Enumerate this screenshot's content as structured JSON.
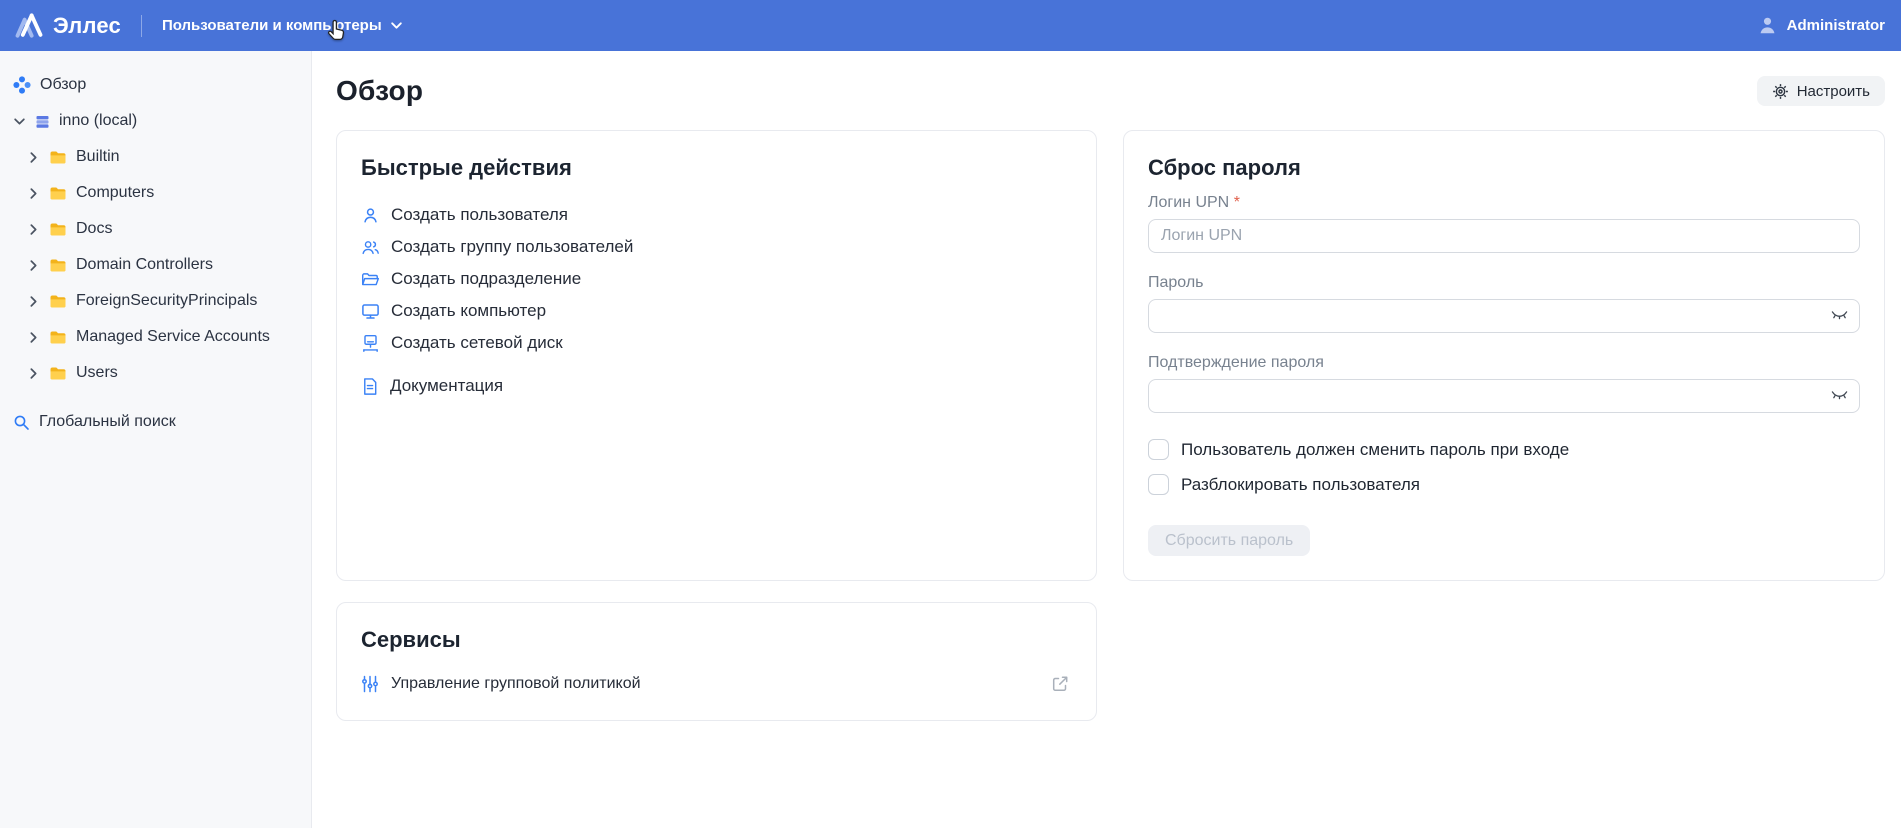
{
  "header": {
    "logo_text": "Эллес",
    "app_switcher_label": "Пользователи и компьютеры",
    "user_label": "Administrator"
  },
  "sidebar": {
    "overview_label": "Обзор",
    "domain_label": "inno (local)",
    "tree_items": [
      "Builtin",
      "Computers",
      "Docs",
      "Domain Controllers",
      "ForeignSecurityPrincipals",
      "Managed Service Accounts",
      "Users"
    ],
    "global_search_label": "Глобальный поиск"
  },
  "main": {
    "page_title": "Обзор",
    "configure_button_label": "Настроить",
    "quick_actions": {
      "title": "Быстрые действия",
      "items": [
        {
          "label": "Создать пользователя",
          "icon": "user-icon"
        },
        {
          "label": "Создать группу пользователей",
          "icon": "user-group-icon"
        },
        {
          "label": "Создать подразделение",
          "icon": "open-folder-icon"
        },
        {
          "label": "Создать компьютер",
          "icon": "monitor-icon"
        },
        {
          "label": "Создать сетевой диск",
          "icon": "network-drive-icon"
        }
      ],
      "docs_item": {
        "label": "Документация",
        "icon": "document-icon"
      }
    },
    "password_reset": {
      "title": "Сброс пароля",
      "upn_label": "Логин UPN",
      "required_mark": "*",
      "upn_placeholder": "Логин UPN",
      "password_label": "Пароль",
      "confirm_label": "Подтверждение пароля",
      "checkboxes": [
        "Пользователь должен сменить пароль при входе",
        "Разблокировать пользователя"
      ],
      "submit_label": "Сбросить пароль",
      "submit_disabled": true
    },
    "services": {
      "title": "Сервисы",
      "items": [
        {
          "label": "Управление групповой политикой",
          "icon": "sliders-icon"
        }
      ]
    }
  },
  "colors": {
    "topbar_blue": "#4873d8",
    "accent_blue": "#3b82f6",
    "folder_yellow": "#ffc53d",
    "sidebar_bg": "#f7f8fa",
    "disabled_button_bg": "#eef0f4",
    "required_red": "#e0604c"
  }
}
